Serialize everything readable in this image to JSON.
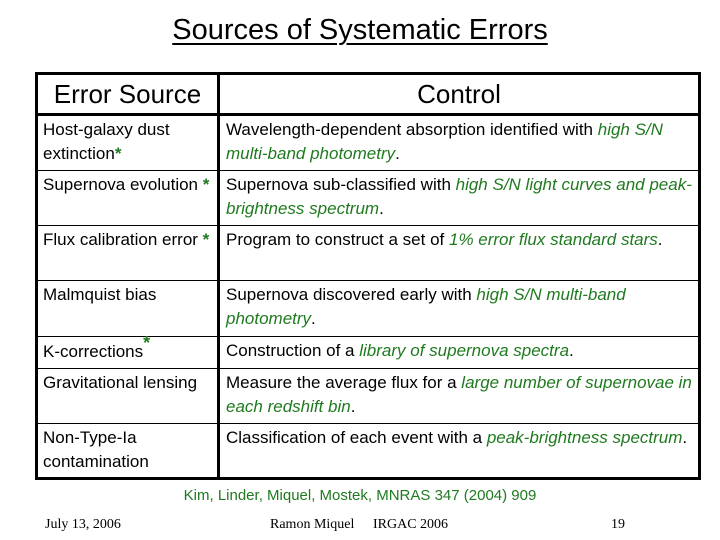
{
  "title": "Sources of Systematic Errors",
  "table": {
    "headers": [
      "Error Source",
      "Control"
    ],
    "rows": [
      {
        "source": "Host-galaxy dust extinction",
        "star": "*",
        "control_plain": "Wavelength-dependent absorption identified with ",
        "control_highlight": "high S/N multi-band photometry",
        "control_after": "."
      },
      {
        "source": "Supernova evolution ",
        "star": "*",
        "control_plain": "Supernova sub-classified with ",
        "control_highlight": "high S/N light curves and peak-brightness spectrum",
        "control_after": "."
      },
      {
        "source": "Flux calibration error ",
        "star": "*",
        "control_plain": "Program to construct a set of ",
        "control_highlight": "1% error flux standard stars",
        "control_after": "."
      },
      {
        "source": "Malmquist bias",
        "star": "",
        "control_plain": "Supernova discovered early with ",
        "control_highlight": "high S/N multi-band photometry",
        "control_after": "."
      },
      {
        "source": "K-corrections",
        "star": "*",
        "control_plain": "Construction of a ",
        "control_highlight": "library of supernova spectra",
        "control_after": "."
      },
      {
        "source": "Gravitational lensing",
        "star": "",
        "control_plain": "Measure the average flux for a ",
        "control_highlight": "large number of supernovae in each redshift bin",
        "control_after": "."
      },
      {
        "source": "Non-Type-Ia contamination",
        "star": "",
        "control_plain": "Classification of each event with a ",
        "control_highlight": "peak-brightness spectrum",
        "control_after": "."
      }
    ]
  },
  "reference": "Kim, Linder, Miquel, Mostek, MNRAS 347 (2004) 909",
  "footer": {
    "date": "July 13, 2006",
    "author": "Ramon Miquel",
    "conference": "IRGAC 2006",
    "page": "19"
  },
  "colors": {
    "highlight": "#1f7a1f"
  }
}
